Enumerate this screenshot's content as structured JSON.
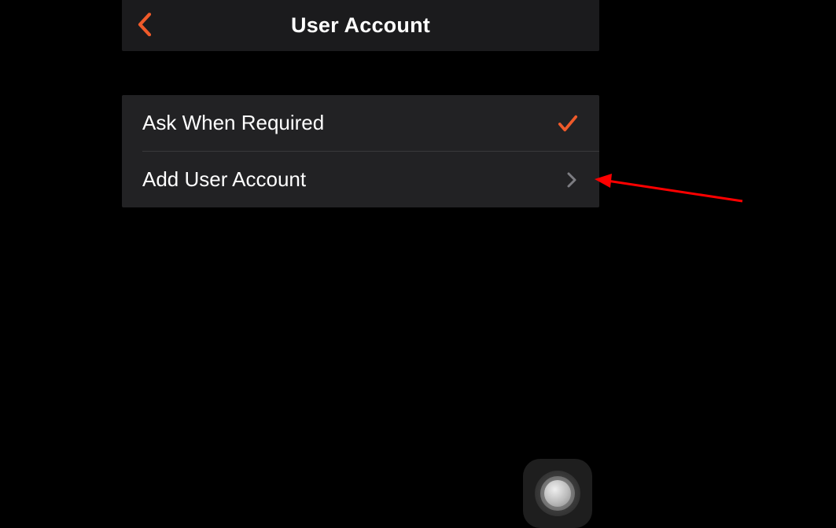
{
  "header": {
    "title": "User Account"
  },
  "list": {
    "items": [
      {
        "label": "Ask When Required",
        "selected": true
      },
      {
        "label": "Add User Account",
        "selected": false
      }
    ]
  },
  "colors": {
    "accent": "#ef5a2a",
    "disclosure": "#7d7d82",
    "annotation": "#ff0000"
  }
}
